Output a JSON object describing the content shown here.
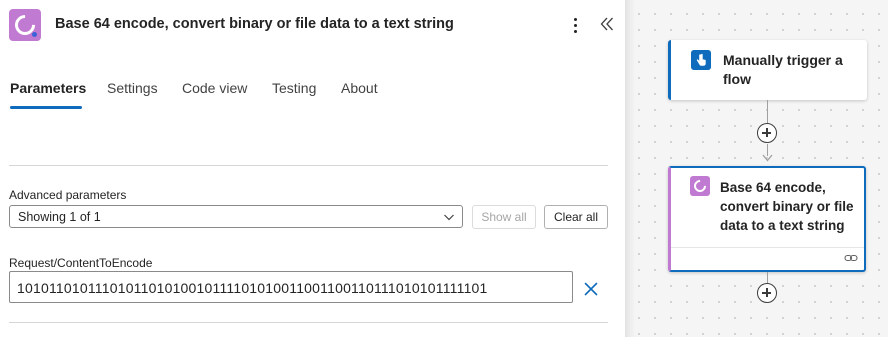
{
  "header": {
    "title": "Base 64 encode, convert binary or file data to a text string",
    "app_icon": "connector-c-icon",
    "more_icon": "more-vertical-icon",
    "collapse_icon": "double-chevron-left-icon"
  },
  "tabs": [
    {
      "label": "Parameters",
      "active": true
    },
    {
      "label": "Settings",
      "active": false
    },
    {
      "label": "Code view",
      "active": false
    },
    {
      "label": "Testing",
      "active": false
    },
    {
      "label": "About",
      "active": false
    }
  ],
  "advanced": {
    "label": "Advanced parameters",
    "selected": "Showing 1 of 1",
    "show_all_label": "Show all",
    "clear_all_label": "Clear all"
  },
  "field": {
    "label": "Request/ContentToEncode",
    "value": "1010110101110101101010010111101010011001100110111010101111101",
    "clear_icon": "close-icon"
  },
  "canvas": {
    "trigger": {
      "title": "Manually trigger a flow",
      "icon": "touch-hand-icon"
    },
    "action": {
      "title": "Base 64 encode, convert binary or file data to a text string",
      "icon": "connector-c-icon",
      "footer_icon": "link-icon"
    },
    "add_icon": "plus-circle-icon"
  },
  "colors": {
    "accent": "#0f6cbd",
    "connector": "#c17ad1"
  }
}
